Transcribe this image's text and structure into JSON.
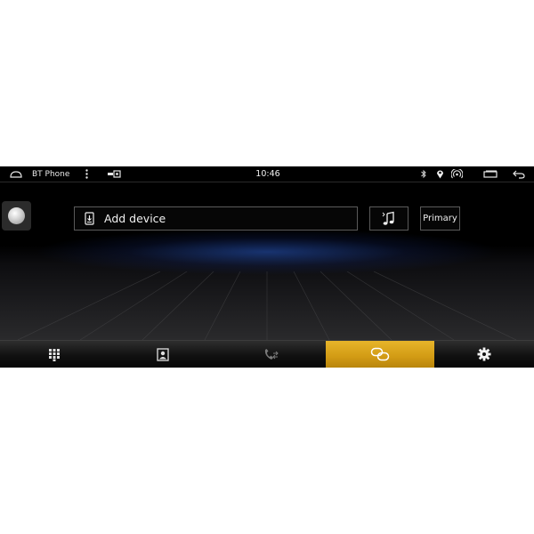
{
  "status_bar": {
    "app_title": "BT Phone",
    "time": "10:46",
    "icons": [
      "home-icon",
      "overflow-menu-icon",
      "usb-icon",
      "bluetooth-icon",
      "location-icon",
      "signal-icon",
      "window-icon",
      "back-icon"
    ]
  },
  "main": {
    "add_device_label": "Add device",
    "primary_label": "Primary",
    "icons": [
      "assistive-touch-icon",
      "phone-download-icon",
      "music-note-icon"
    ]
  },
  "bottom_nav": {
    "items": [
      {
        "name": "dialpad",
        "icon": "dialpad-icon",
        "active": false
      },
      {
        "name": "contacts",
        "icon": "contacts-icon",
        "active": false
      },
      {
        "name": "call-log",
        "icon": "call-log-icon",
        "active": false
      },
      {
        "name": "pairing",
        "icon": "link-icon",
        "active": true
      },
      {
        "name": "settings",
        "icon": "gear-icon",
        "active": false
      }
    ]
  },
  "colors": {
    "accent": "#d7a11a",
    "background": "#000000",
    "text": "#f2f2f2"
  }
}
